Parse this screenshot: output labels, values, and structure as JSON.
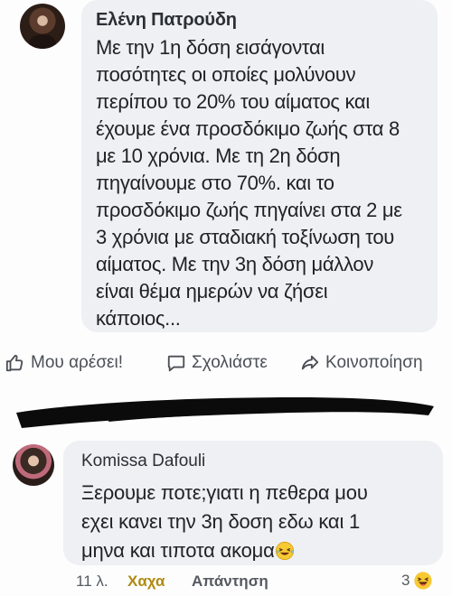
{
  "comment1": {
    "author": "Ελένη Πατρούδη",
    "lines": [
      "Με την 1η δόση εισάγονται",
      "ποσότητες οι οποίες μολύνουν",
      "περίπου το 20% του αίματος και",
      "έχουμε ένα προσδόκιμο ζωής στα 8",
      "με 10 χρόνια. Με τη 2η δόση",
      "πηγαίνουμε στο 70%. και το",
      "προσδόκιμο ζωής πηγαίνει στα 2 με",
      "3 χρόνια με σταδιακή τοξίνωση του",
      "αίματος. Με την 3η δόση μάλλον",
      "είναι θέμα ημερών να ζήσει",
      "κάποιος..."
    ]
  },
  "actions": {
    "like": "Μου αρέσει!",
    "comment": "Σχολιάστε",
    "share": "Κοινοποίηση"
  },
  "comment2": {
    "author": "Komissa Dafouli",
    "lines": [
      "Ξερουμε ποτε;γιατι η πεθερα μου",
      "εχει κανει την 3η δοση εδω και 1",
      "μηνα και τιποτα ακομα"
    ],
    "emoji": "laughing-tears-emoji"
  },
  "meta": {
    "time": "11 λ.",
    "reaction": "Χαχα",
    "reply": "Απάντηση",
    "reaction_count": "3"
  },
  "colors": {
    "bubble": "#eef0f3",
    "haha_link": "#b08a12",
    "emoji_yellow": "#f7c932"
  }
}
